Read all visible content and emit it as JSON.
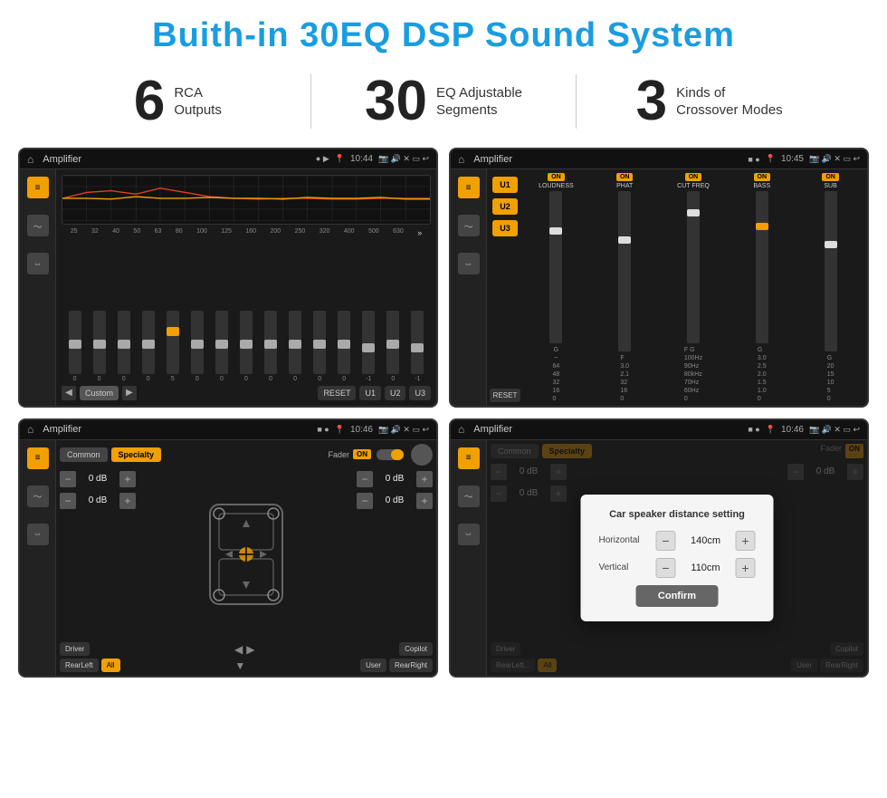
{
  "page": {
    "title": "Buith-in 30EQ DSP Sound System"
  },
  "stats": [
    {
      "number": "6",
      "label": "RCA\nOutputs"
    },
    {
      "number": "30",
      "label": "EQ Adjustable\nSegments"
    },
    {
      "number": "3",
      "label": "Kinds of\nCrossover Modes"
    }
  ],
  "screens": [
    {
      "id": "eq",
      "status_title": "Amplifier",
      "time": "10:44",
      "eq_labels": [
        "25",
        "32",
        "40",
        "50",
        "63",
        "80",
        "100",
        "125",
        "160",
        "200",
        "250",
        "320",
        "400",
        "500",
        "630"
      ],
      "eq_values": [
        "0",
        "0",
        "0",
        "0",
        "5",
        "0",
        "0",
        "0",
        "0",
        "0",
        "0",
        "0",
        "-1",
        "0",
        "-1"
      ],
      "eq_preset": "Custom",
      "buttons": [
        "RESET",
        "U1",
        "U2",
        "U3"
      ]
    },
    {
      "id": "crossover",
      "status_title": "Amplifier",
      "time": "10:45",
      "presets": [
        "U1",
        "U2",
        "U3"
      ],
      "channels": [
        "LOUDNESS",
        "PHAT",
        "CUT FREQ",
        "BASS",
        "SUB"
      ],
      "reset_btn": "RESET"
    },
    {
      "id": "fader",
      "status_title": "Amplifier",
      "time": "10:46",
      "tabs": [
        "Common",
        "Specialty"
      ],
      "fader_label": "Fader",
      "on_label": "ON",
      "db_values": [
        "0 dB",
        "0 dB",
        "0 dB",
        "0 dB"
      ],
      "buttons": [
        "Driver",
        "RearLeft",
        "All",
        "User",
        "Copilot",
        "RearRight"
      ]
    },
    {
      "id": "distance",
      "status_title": "Amplifier",
      "time": "10:46",
      "tabs": [
        "Common",
        "Specialty"
      ],
      "on_label": "ON",
      "dialog": {
        "title": "Car speaker distance setting",
        "horizontal_label": "Horizontal",
        "horizontal_value": "140cm",
        "vertical_label": "Vertical",
        "vertical_value": "110cm",
        "confirm_label": "Confirm"
      },
      "buttons": [
        "Driver",
        "RearLeft",
        "All",
        "User",
        "Copilot",
        "RearRight"
      ]
    }
  ]
}
